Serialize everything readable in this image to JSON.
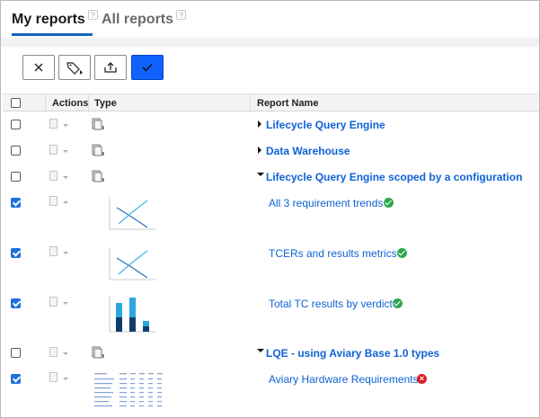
{
  "tabs": {
    "my_reports": "My reports",
    "all_reports": "All reports",
    "help_glyph": "?"
  },
  "toolbar": {
    "buttons": [
      {
        "name": "close",
        "icon": "close-icon"
      },
      {
        "name": "tag",
        "icon": "tag-icon"
      },
      {
        "name": "export",
        "icon": "upload-icon"
      },
      {
        "name": "confirm",
        "icon": "check-icon"
      }
    ],
    "accent": "#0f62fe"
  },
  "table": {
    "headers": {
      "actions": "Actions",
      "type": "Type",
      "report_name": "Report Name"
    },
    "rows": [
      {
        "kind": "folder",
        "label": "Lifecycle Query Engine",
        "checked": false,
        "expanded": false
      },
      {
        "kind": "folder",
        "label": "Data Warehouse",
        "checked": false,
        "expanded": false
      },
      {
        "kind": "folder",
        "label": "Lifecycle Query Engine scoped by a configuration",
        "checked": false,
        "expanded": true
      },
      {
        "kind": "report",
        "label": "All 3 requirement trends",
        "checked": true,
        "status": "ok",
        "thumb": "line-chart"
      },
      {
        "kind": "report",
        "label": "TCERs and results metrics",
        "checked": true,
        "status": "ok",
        "thumb": "line-chart"
      },
      {
        "kind": "report",
        "label": "Total TC results by verdict",
        "checked": true,
        "status": "ok",
        "thumb": "bar-chart"
      },
      {
        "kind": "folder",
        "label": "LQE - using Aviary Base 1.0 types",
        "checked": false,
        "expanded": true
      },
      {
        "kind": "report",
        "label": "Aviary Hardware Requirements",
        "checked": true,
        "status": "error",
        "thumb": "table"
      }
    ]
  },
  "colors": {
    "link": "#0f62d6",
    "ok": "#2fa84f",
    "error": "#da1e28",
    "checkbox": "#1f6fe0"
  }
}
